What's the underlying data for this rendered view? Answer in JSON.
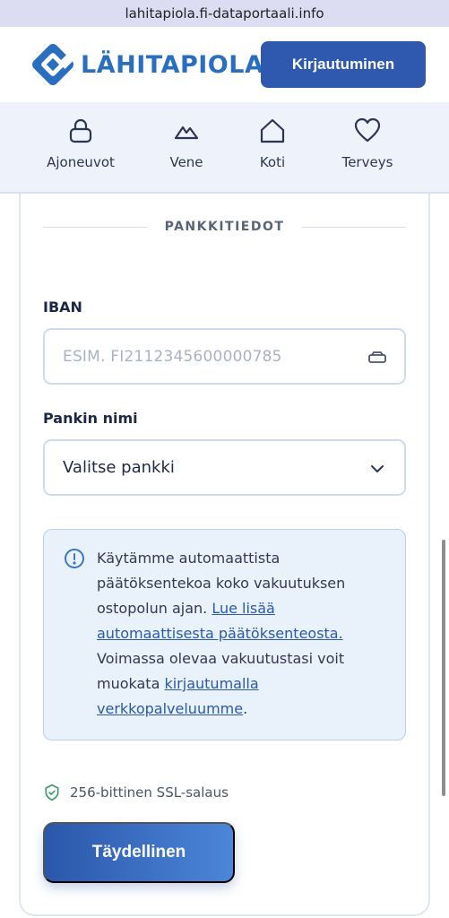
{
  "browser": {
    "url": "lahitapiola.fi-dataportaali.info"
  },
  "header": {
    "logo_text": "LÄHITAPIOLA",
    "login_label": "Kirjautuminen"
  },
  "nav": {
    "items": [
      {
        "label": "Ajoneuvot",
        "icon": "lock-icon"
      },
      {
        "label": "Vene",
        "icon": "mountain-icon"
      },
      {
        "label": "Koti",
        "icon": "home-icon"
      },
      {
        "label": "Terveys",
        "icon": "heart-icon"
      }
    ]
  },
  "form": {
    "section_title": "PANKKITIEDOT",
    "iban_label": "IBAN",
    "iban_placeholder": "ESIM. FI2112345600000785",
    "bank_label": "Pankin nimi",
    "bank_value": "Valitse pankki"
  },
  "info": {
    "text_1": "Käytämme automaattista päätöksentekoa koko vakuutuksen ostopolun ajan. ",
    "link_1": "Lue lisää automaattisesta päätöksenteosta.",
    "text_2": " Voimassa olevaa vakuutustasi voit muokata ",
    "link_2": "kirjautumalla verkkopalveluumme",
    "text_3": "."
  },
  "ssl_text": "256-bittinen SSL-salaus",
  "submit_label": "Täydellinen",
  "colors": {
    "brand": "#2a6fbf",
    "button": "#2f59ae",
    "nav_bg": "#eef3fb",
    "info_bg": "#e9f1fb",
    "ssl_green": "#3a9a6b"
  }
}
